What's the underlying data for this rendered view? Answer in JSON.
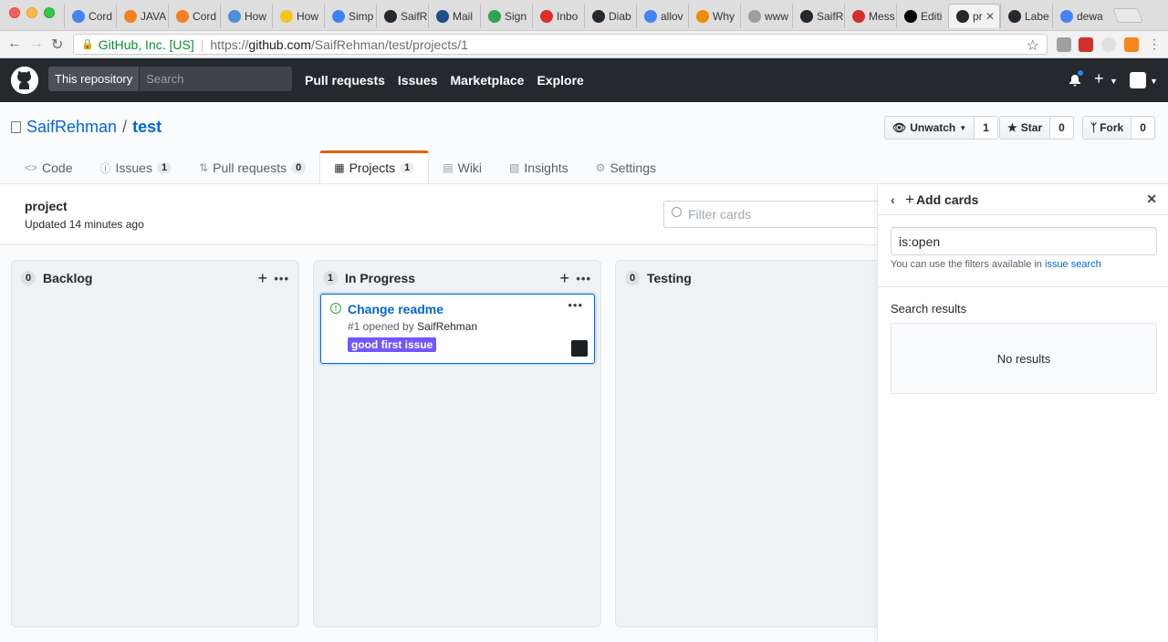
{
  "browser": {
    "tabs": [
      {
        "title": "Cord",
        "icon": "google-icon",
        "color": "#4285f4"
      },
      {
        "title": "JAVA",
        "icon": "stackoverflow-icon",
        "color": "#f48024"
      },
      {
        "title": "Cord",
        "icon": "stackoverflow-icon",
        "color": "#f48024"
      },
      {
        "title": "How",
        "icon": "site-icon",
        "color": "#4a90d9"
      },
      {
        "title": "How",
        "icon": "duck-icon",
        "color": "#f5c518"
      },
      {
        "title": "Simp",
        "icon": "number-icon",
        "color": "#3b82f6"
      },
      {
        "title": "SaifR",
        "icon": "github-icon",
        "color": "#24292e"
      },
      {
        "title": "Mail",
        "icon": "mail-icon",
        "color": "#1d4e89"
      },
      {
        "title": "Sign",
        "icon": "check-icon",
        "color": "#2ea44f"
      },
      {
        "title": "Inbo",
        "icon": "gmail-icon",
        "color": "#d93025"
      },
      {
        "title": "Diab",
        "icon": "github-icon",
        "color": "#24292e"
      },
      {
        "title": "allov",
        "icon": "google-icon",
        "color": "#4285f4"
      },
      {
        "title": "Why",
        "icon": "site-icon",
        "color": "#f28c00"
      },
      {
        "title": "www",
        "icon": "page-icon",
        "color": "#9e9e9e"
      },
      {
        "title": "SaifR",
        "icon": "github-icon",
        "color": "#24292e"
      },
      {
        "title": "Mess",
        "icon": "medium-m-icon",
        "color": "#d32f2f"
      },
      {
        "title": "Editi",
        "icon": "medium-icon",
        "color": "#000000"
      },
      {
        "title": "pr",
        "icon": "github-icon",
        "color": "#24292e",
        "active": true
      },
      {
        "title": "Labe",
        "icon": "github-icon",
        "color": "#24292e"
      },
      {
        "title": "dewa",
        "icon": "google-icon",
        "color": "#4285f4"
      }
    ],
    "secure_label": "GitHub, Inc. [US]",
    "url_scheme": "https://",
    "url_host": "github.com",
    "url_path": "/SaifRehman/test/projects/1"
  },
  "header": {
    "scope_label": "This repository",
    "search_placeholder": "Search",
    "nav": [
      "Pull requests",
      "Issues",
      "Marketplace",
      "Explore"
    ]
  },
  "repo": {
    "owner": "SaifRehman",
    "separator": "/",
    "name": "test",
    "unwatch_label": "Unwatch",
    "watch_count": "1",
    "star_label": "Star",
    "star_count": "0",
    "fork_label": "Fork",
    "fork_count": "0",
    "tabs": [
      {
        "label": "Code",
        "icon": "code-icon"
      },
      {
        "label": "Issues",
        "icon": "issue-icon",
        "count": "1"
      },
      {
        "label": "Pull requests",
        "icon": "pull-request-icon",
        "count": "0"
      },
      {
        "label": "Projects",
        "icon": "project-icon",
        "count": "1",
        "selected": true
      },
      {
        "label": "Wiki",
        "icon": "wiki-icon"
      },
      {
        "label": "Insights",
        "icon": "graph-icon"
      },
      {
        "label": "Settings",
        "icon": "gear-icon"
      }
    ]
  },
  "project": {
    "name": "project",
    "updated": "Updated 14 minutes ago",
    "filter_placeholder": "Filter cards"
  },
  "columns": [
    {
      "name": "Backlog",
      "count": "0"
    },
    {
      "name": "In Progress",
      "count": "1"
    },
    {
      "name": "Testing",
      "count": "0"
    }
  ],
  "card": {
    "title": "Change readme",
    "meta_prefix": "#1 opened by",
    "author": "SaifRehman",
    "label": "good first issue",
    "label_color": "#7057ff"
  },
  "sidebar": {
    "title": "Add cards",
    "query": "is:open",
    "hint_prefix": "You can use the filters available in",
    "hint_link": "issue search",
    "results_label": "Search results",
    "no_results": "No results"
  }
}
